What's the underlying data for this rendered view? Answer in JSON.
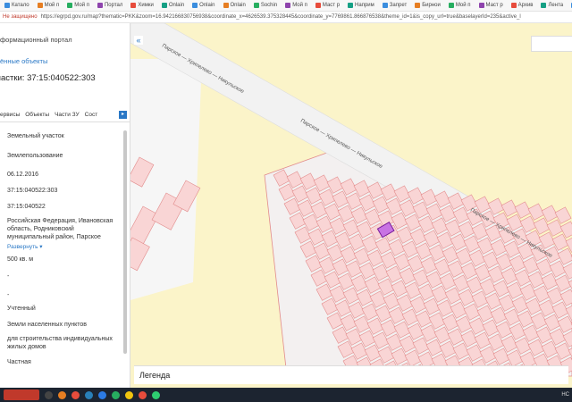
{
  "browser": {
    "bookmarks": [
      "Катало",
      "Мой п",
      "Мой п",
      "Портал",
      "Химки",
      "Onlain",
      "Onlain",
      "Onlain",
      "Sochin",
      "Мой п",
      "Маст р",
      "Наприм",
      "Запрет",
      "Бирнои",
      "Мой п",
      "Маст р",
      "Архив",
      "Лента",
      "Улица",
      "Провер"
    ],
    "security_label": "Не защищено",
    "url": "https://egrpd.gov.ru/map?thematic=PKK&zoom=16.942166830756938&coordinate_x=4626539.375328445&coordinate_y=7769861.866876538&theme_id=1&is_copy_url=true&baselayerId=235&active_l"
  },
  "sidebar": {
    "portal_title": "формационный портал",
    "objects_link": "ённые объекты",
    "parcel_heading": "частки: 37:15:040522:303",
    "tabs": [
      "ервисы",
      "Объекты",
      "Части ЗУ",
      "Сост"
    ],
    "tab_arrow": "▸",
    "fields": [
      "Земельный участок",
      "Землепользование",
      "06.12.2016",
      "37:15:040522:303",
      "37:15:040522",
      "Российская Федерация, Ивановская область, Родниковский муниципальный район, Парское",
      "Развернуть ▾",
      "500 кв. м",
      "-",
      "-",
      "Учтенный",
      "Земли населенных пунктов",
      "для строительства индивидуальных жилых домов",
      "Частная"
    ]
  },
  "map": {
    "collapse_label": "«",
    "road_labels": [
      "Парское — Хрипелево — Никульское",
      "Парское — Хрипелево — Никульское",
      "Парское — Хрипелево — Никульское"
    ],
    "legend_label": "Легенда",
    "colors": {
      "land": "#fbf4c9",
      "road": "#f2f2f2",
      "parcel_fill": "#f9d5d5",
      "parcel_stroke": "#e28b8b",
      "selected": "#b845d0"
    }
  },
  "taskbar": {
    "tray_text": "НС"
  }
}
